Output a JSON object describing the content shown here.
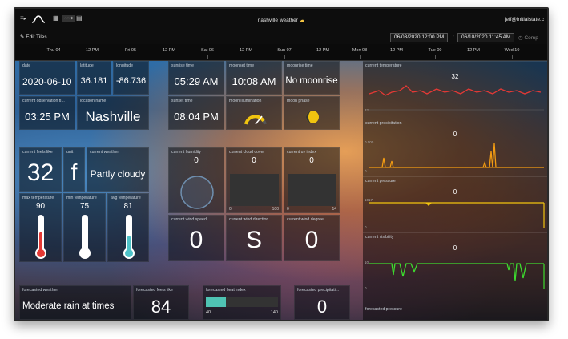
{
  "topbar": {
    "title": "nashville weather",
    "title_icon": "sun-cloud-emoji",
    "user": "jeff@initialstate.c",
    "icons": [
      "menu-icon",
      "logo-wave-icon",
      "grid-view-icon",
      "chart-view-icon",
      "list-view-icon"
    ]
  },
  "toolbar": {
    "edit_label": "Edit Tiles",
    "start_datetime": "06/03/2020 12:00 PM",
    "separator": ":",
    "end_datetime": "06/10/2020 11:45 AM",
    "extra_label": "Comp"
  },
  "timeline": {
    "ticks": [
      "Thu 04",
      "12 PM",
      "Fri 05",
      "12 PM",
      "Sat 06",
      "12 PM",
      "Sun 07",
      "12 PM",
      "Mon 08",
      "12 PM",
      "Tue 09",
      "12 PM",
      "Wed 10"
    ]
  },
  "tiles": {
    "date": {
      "label": "date",
      "value": "2020-06-10"
    },
    "latitude": {
      "label": "latitude",
      "value": "36.181"
    },
    "longitude": {
      "label": "longitude",
      "value": "-86.736"
    },
    "sunrise": {
      "label": "sunrise time",
      "value": "05:29 AM"
    },
    "moonset": {
      "label": "moonset time",
      "value": "10:08 AM"
    },
    "moonrise": {
      "label": "moonrise time",
      "value": "No moonrise"
    },
    "observation": {
      "label": "current observation ti...",
      "value": "03:25 PM"
    },
    "location": {
      "label": "location name",
      "value": "Nashville"
    },
    "sunset": {
      "label": "sunset time",
      "value": "08:04 PM"
    },
    "moon_illum": {
      "label": "moon illumination"
    },
    "moon_phase": {
      "label": "moon phase"
    },
    "feels_like": {
      "label": "current feels like",
      "value": "32"
    },
    "unit": {
      "label": "unit",
      "value": "f"
    },
    "weather": {
      "label": "current weather",
      "value": "Partly cloudy"
    },
    "humidity": {
      "label": "current humidity",
      "value": "0"
    },
    "cloud_cover": {
      "label": "current cloud cover",
      "value": "0",
      "min": "0",
      "max": "100"
    },
    "uv_index": {
      "label": "current uv index",
      "value": "0",
      "min": "0",
      "max": "14"
    },
    "max_temp": {
      "label": "max temperature",
      "value": "90",
      "fill": 0.55,
      "color": "#e53935"
    },
    "min_temp": {
      "label": "min temperature",
      "value": "75",
      "fill": 0.4,
      "color": "#ffffff"
    },
    "avg_temp": {
      "label": "avg temperature",
      "value": "81",
      "fill": 0.45,
      "color": "#4fc3c9"
    },
    "wind_speed": {
      "label": "current wind speed",
      "value": "0"
    },
    "wind_dir": {
      "label": "current wind direction",
      "value": "S"
    },
    "wind_degree": {
      "label": "current wind degree",
      "value": "0"
    },
    "forecast_weather": {
      "label": "forecasted weather",
      "value": "Moderate rain at times"
    },
    "forecast_feels": {
      "label": "forecasted feels like",
      "value": "84"
    },
    "heat_index": {
      "label": "forecasted heat index",
      "min": "40",
      "max": "140",
      "fill": 0.28
    },
    "forecast_precip": {
      "label": "forecasted precipitati...",
      "value": "0"
    }
  },
  "charts": {
    "temperature": {
      "label": "current temperature",
      "value": "32",
      "ymin": "32",
      "color": "#e53935"
    },
    "precipitation": {
      "label": "current precipitation",
      "value": "0",
      "ymax": "0.000",
      "ymin": "0",
      "color": "#f39c12"
    },
    "pressure": {
      "label": "current pressure",
      "value": "0",
      "ymax": "1017",
      "ymin": "0",
      "color": "#f1c40f"
    },
    "visibility": {
      "label": "current visibility",
      "value": "0",
      "ymax": "10",
      "ymin": "0",
      "color": "#3ddc2f"
    },
    "forecast_pressure": {
      "label": "forecasted pressure"
    }
  }
}
